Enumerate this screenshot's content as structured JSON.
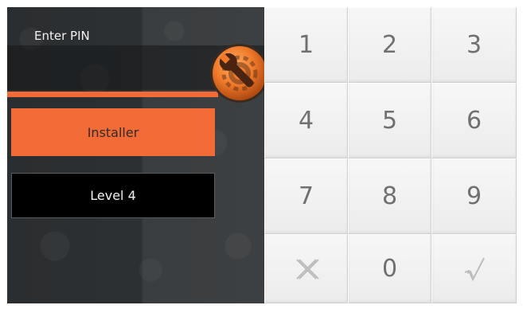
{
  "header": {
    "title": "Enter PIN"
  },
  "pin": {
    "value": ""
  },
  "menu": {
    "installer_label": "Installer",
    "level_label": "Level 4"
  },
  "keypad": {
    "keys": [
      "1",
      "2",
      "3",
      "4",
      "5",
      "6",
      "7",
      "8",
      "9",
      "0"
    ],
    "clear_icon": "x-icon",
    "confirm_icon": "check-icon"
  },
  "colors": {
    "accent": "#f26a36",
    "panel": "#2b2e30",
    "key": "#f2f2f2",
    "key_text": "#707070"
  }
}
